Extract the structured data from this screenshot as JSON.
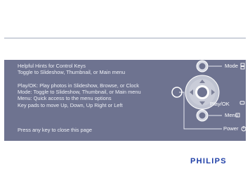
{
  "hints": {
    "title": "Helpful Hints for Control Keys",
    "subtitle": "Toggle to Slideshow, Thumbnail, or Main menu",
    "lines": [
      "Play/OK: Play photos in Slideshow, Browse, or Clock",
      "Mode: Toggle to Slideshow, Thumbnail, or Main menu",
      "Menu: Quick access to the menu options",
      "Key pads to move Up, Down, Up Right or Left"
    ],
    "close_hint": "Press any key to close this page"
  },
  "controls": {
    "mode_label": "Mode",
    "play_label": "Play/OK",
    "menu_label": "Menu",
    "power_label": "Power"
  },
  "brand": {
    "logo": "PHILIPS"
  },
  "colors": {
    "panel": "#6e7390",
    "brand": "#1f3fa7"
  }
}
